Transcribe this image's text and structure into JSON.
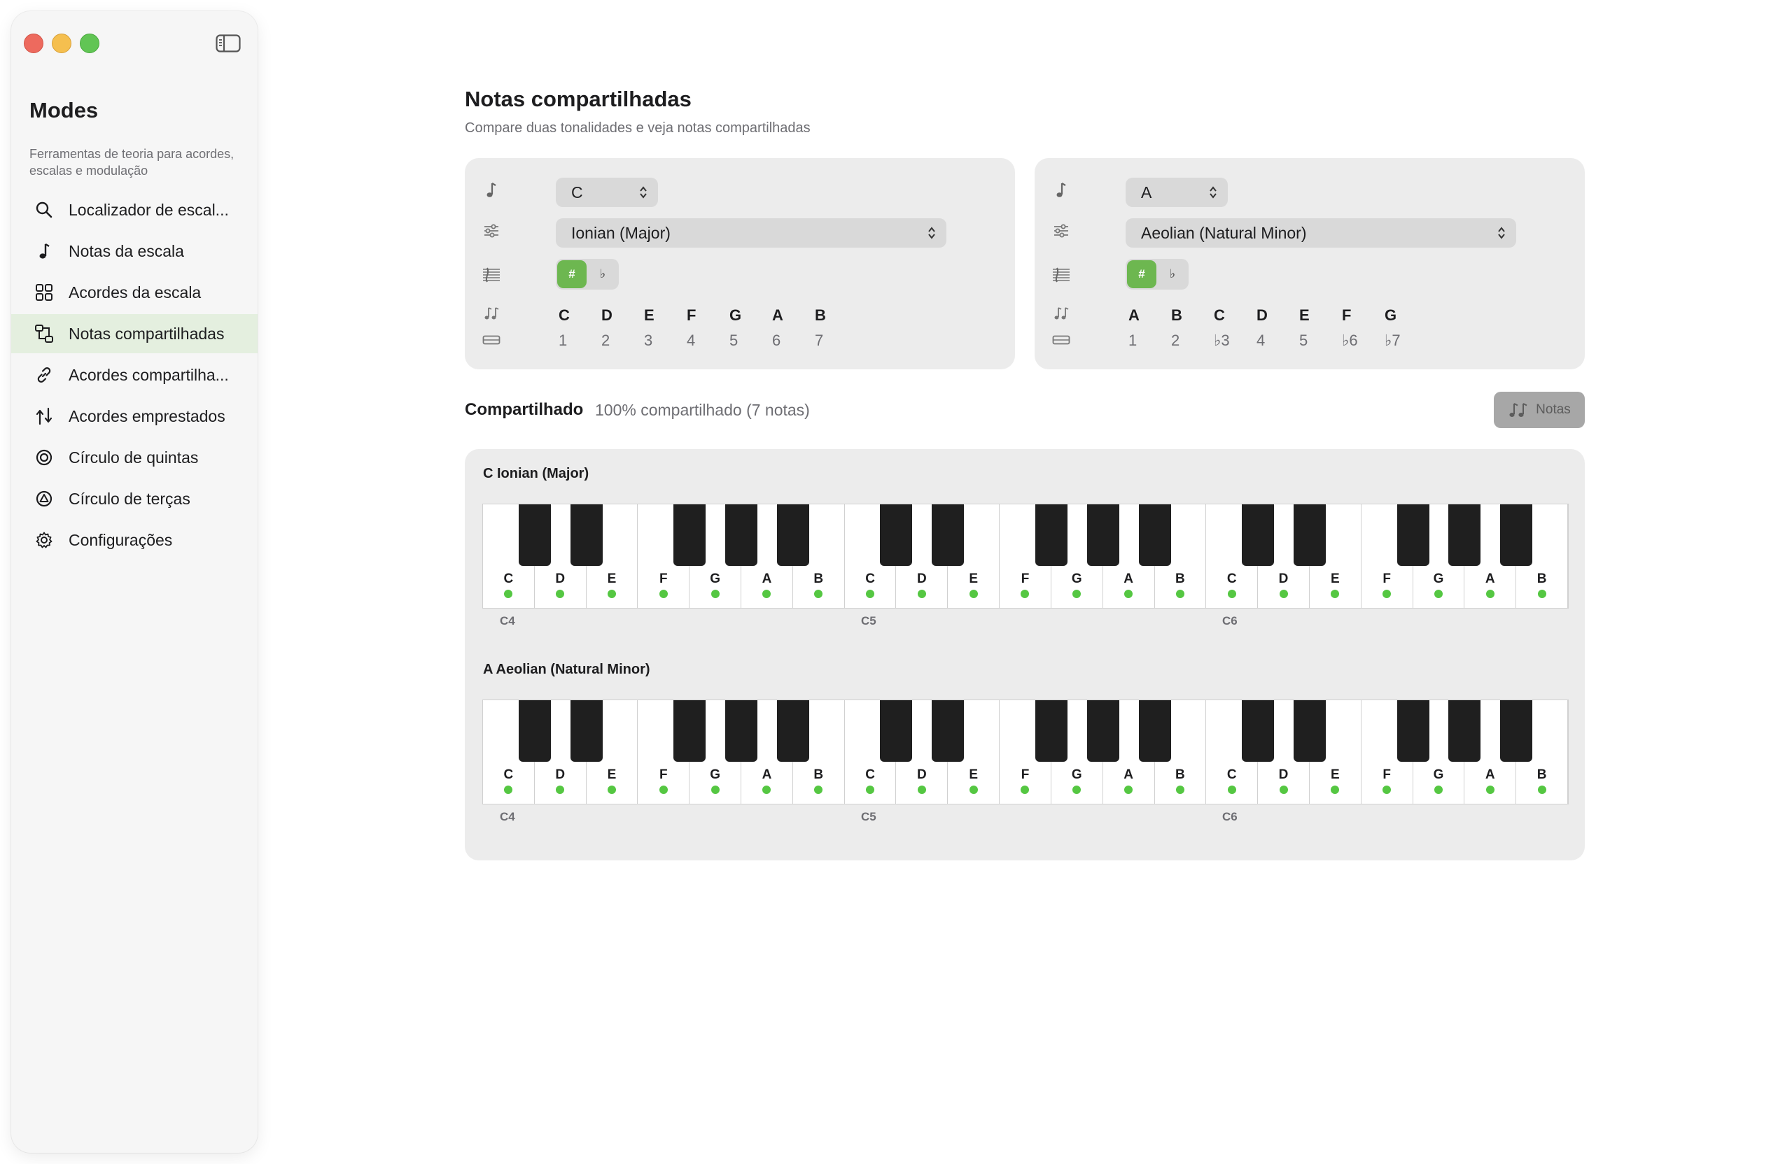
{
  "sidebar": {
    "title": "Modes",
    "subtitle": "Ferramentas de teoria para acordes, escalas e modulação",
    "items": [
      {
        "label": "Localizador de escal...",
        "icon": "search-icon"
      },
      {
        "label": "Notas da escala",
        "icon": "note-icon"
      },
      {
        "label": "Acordes da escala",
        "icon": "grid-icon"
      },
      {
        "label": "Notas compartilhadas",
        "icon": "shared-notes-icon",
        "active": true
      },
      {
        "label": "Acordes compartilha...",
        "icon": "link-icon"
      },
      {
        "label": "Acordes emprestados",
        "icon": "borrow-icon"
      },
      {
        "label": "Círculo de quintas",
        "icon": "circle-icon"
      },
      {
        "label": "Círculo de terças",
        "icon": "triangle-circle-icon"
      },
      {
        "label": "Configurações",
        "icon": "gear-icon"
      }
    ]
  },
  "page": {
    "title": "Notas compartilhadas",
    "subtitle": "Compare duas tonalidades e veja notas compartilhadas"
  },
  "key_a": {
    "root": "C",
    "mode": "Ionian (Major)",
    "sharp_label": "#",
    "flat_label": "♭",
    "notes": [
      "C",
      "D",
      "E",
      "F",
      "G",
      "A",
      "B"
    ],
    "degrees": [
      "1",
      "2",
      "3",
      "4",
      "5",
      "6",
      "7"
    ]
  },
  "key_b": {
    "root": "A",
    "mode": "Aeolian (Natural Minor)",
    "sharp_label": "#",
    "flat_label": "♭",
    "notes": [
      "A",
      "B",
      "C",
      "D",
      "E",
      "F",
      "G"
    ],
    "degrees": [
      "1",
      "2",
      "♭3",
      "4",
      "5",
      "♭6",
      "♭7"
    ]
  },
  "shared": {
    "title": "Compartilhado",
    "summary": "100% compartilhado (7 notas)",
    "notes_button": "Notas"
  },
  "keyboards": [
    {
      "title": "C Ionian (Major)",
      "octaves": [
        "C4",
        "C5",
        "C6"
      ],
      "notes": [
        "C",
        "D",
        "E",
        "F",
        "G",
        "A",
        "B",
        "C",
        "D",
        "E",
        "F",
        "G",
        "A",
        "B",
        "C",
        "D",
        "E",
        "F",
        "G",
        "A",
        "B"
      ]
    },
    {
      "title": "A Aeolian (Natural Minor)",
      "octaves": [
        "C4",
        "C5",
        "C6"
      ],
      "notes": [
        "C",
        "D",
        "E",
        "F",
        "G",
        "A",
        "B",
        "C",
        "D",
        "E",
        "F",
        "G",
        "A",
        "B",
        "C",
        "D",
        "E",
        "F",
        "G",
        "A",
        "B"
      ]
    }
  ],
  "colors": {
    "accent_green": "#6db750",
    "dot_green": "#55c742",
    "active_nav": "#e4efdf"
  }
}
